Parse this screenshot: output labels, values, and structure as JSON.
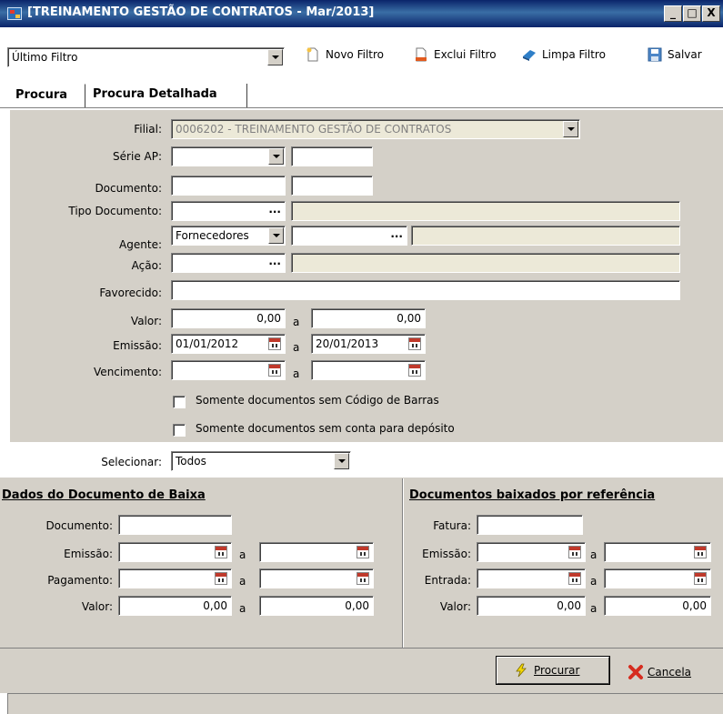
{
  "window": {
    "title": "[TREINAMENTO GESTÃO DE CONTRATOS - Mar/2013]",
    "controls": {
      "minimize": "_",
      "maximize": "□",
      "close": "X"
    }
  },
  "toolbar": {
    "filter_combo_value": "Último Filtro",
    "novo_filtro": "Novo Filtro",
    "exclui_filtro": "Exclui Filtro",
    "limpa_filtro": "Limpa Filtro",
    "salvar": "Salvar"
  },
  "tabs": [
    {
      "label": "Procura",
      "active": true
    },
    {
      "label": "Procura Detalhada",
      "active": false
    }
  ],
  "form": {
    "filial": {
      "label": "Filial:",
      "value": "0006202 - TREINAMENTO GESTÃO DE CONTRATOS"
    },
    "serie_ap": {
      "label": "Série AP:"
    },
    "documento": {
      "label": "Documento:"
    },
    "tipo_documento": {
      "label": "Tipo Documento:",
      "button": "..."
    },
    "agente": {
      "label": "Agente:",
      "value": "Fornecedores",
      "button": "..."
    },
    "acao": {
      "label": "Ação:",
      "button": "..."
    },
    "favorecido": {
      "label": "Favorecido:"
    },
    "valor": {
      "label": "Valor:",
      "from": "0,00",
      "to": "0,00",
      "sep": "a"
    },
    "emissao": {
      "label": "Emissão:",
      "from": "01/01/2012",
      "to": "20/01/2013",
      "sep": "a"
    },
    "vencimento": {
      "label": "Vencimento:",
      "sep": "a"
    },
    "check_sem_codigo_barras": "Somente documentos sem Código de Barras",
    "check_sem_conta_deposito": "Somente documentos sem conta para depósito",
    "selecionar": {
      "label": "Selecionar:",
      "value": "Todos"
    }
  },
  "baixa": {
    "title": "Dados do Documento de Baixa",
    "documento": "Documento:",
    "emissao": "Emissão:",
    "pagamento": "Pagamento:",
    "valor": "Valor:",
    "valor_from": "0,00",
    "valor_to": "0,00",
    "sep": "a"
  },
  "referencia": {
    "title": "Documentos baixados por referência",
    "fatura": "Fatura:",
    "emissao": "Emissão:",
    "entrada": "Entrada:",
    "valor": "Valor:",
    "valor_from": "0,00",
    "valor_to": "0,00",
    "sep": "a"
  },
  "footer": {
    "procurar": "Procurar",
    "cancela": "Cancela"
  },
  "icons": {
    "novo_filtro": "new-document-icon",
    "exclui_filtro": "delete-document-icon",
    "limpa_filtro": "eraser-icon",
    "salvar": "floppy-disk-icon",
    "procurar": "lightning-icon",
    "cancela": "red-x-icon"
  }
}
